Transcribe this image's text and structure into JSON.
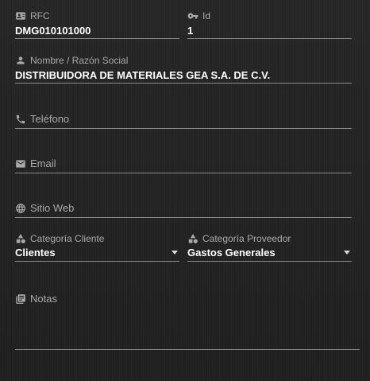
{
  "form": {
    "rfc": {
      "label": "RFC",
      "value": "DMG010101000",
      "icon": "id-card-icon"
    },
    "id": {
      "label": "Id",
      "value": "1",
      "icon": "key-icon"
    },
    "nombre": {
      "label": "Nombre / Razón Social",
      "value": "DISTRIBUIDORA DE MATERIALES GEA S.A. DE C.V.",
      "icon": "person-icon"
    },
    "telefono": {
      "label": "Teléfono",
      "value": "",
      "icon": "phone-icon"
    },
    "email": {
      "label": "Email",
      "value": "",
      "icon": "mail-icon"
    },
    "sitio_web": {
      "label": "Sitio Web",
      "value": "",
      "icon": "globe-icon"
    },
    "categoria_cliente": {
      "label": "Categoría Cliente",
      "value": "Clientes",
      "icon": "shapes-icon"
    },
    "categoria_proveedor": {
      "label": "Categoría Proveedor",
      "value": "Gastos Generales",
      "icon": "shapes-icon"
    },
    "notas": {
      "label": "Notas",
      "value": "",
      "icon": "notes-icon"
    }
  },
  "colors": {
    "background": "#232323",
    "label": "#a9a9a9",
    "value": "#ffffff",
    "underline": "#8a8a8a"
  }
}
